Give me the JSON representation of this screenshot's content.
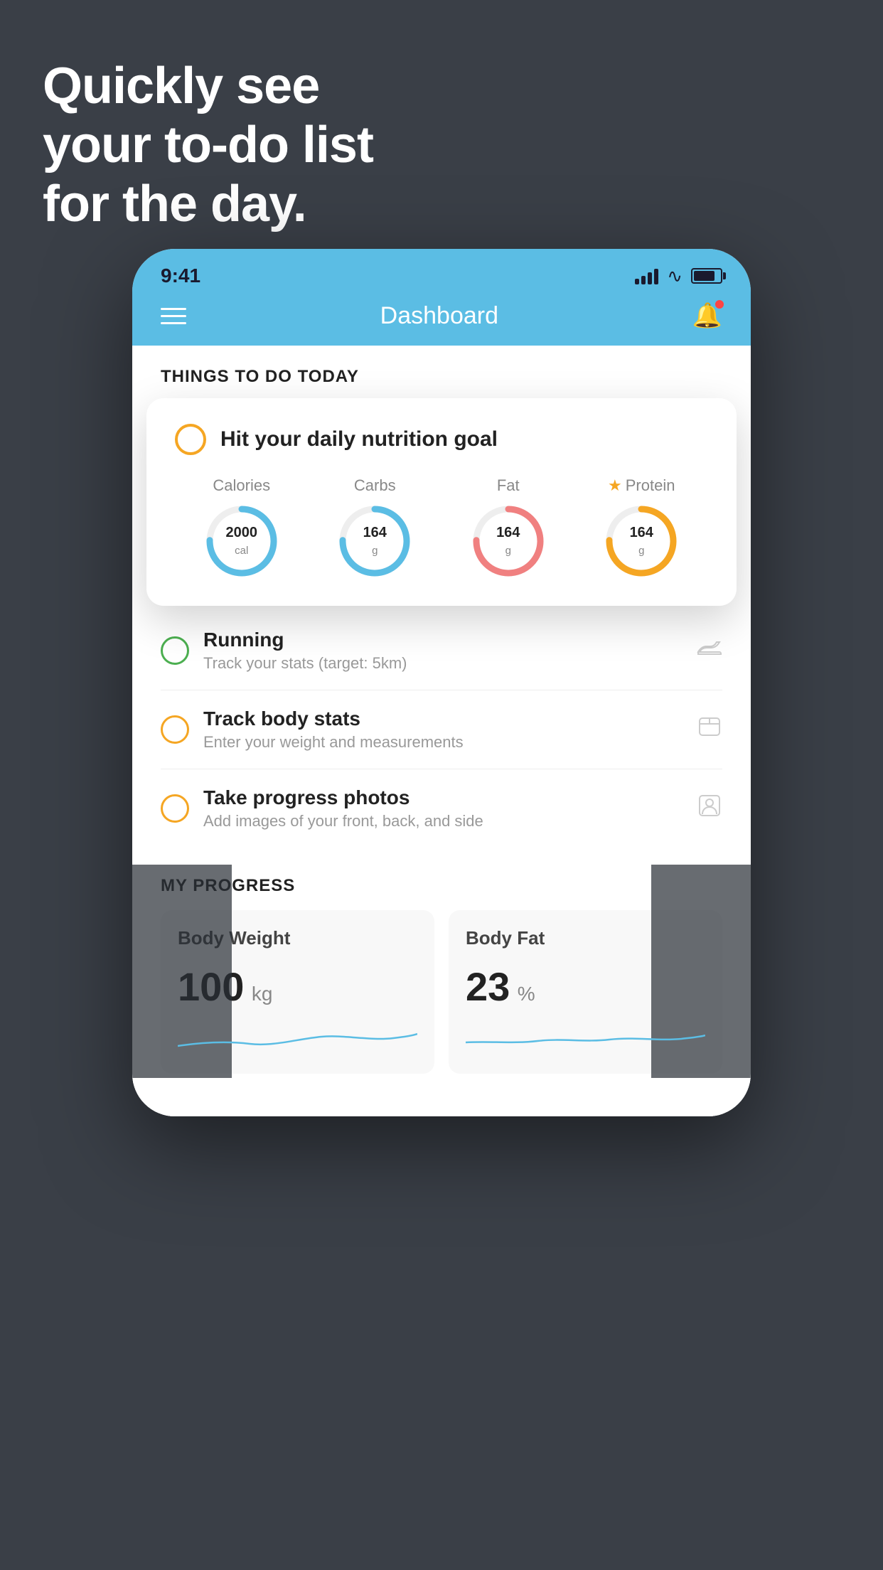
{
  "background": {
    "color": "#3a3f47"
  },
  "headline": {
    "line1": "Quickly see",
    "line2": "your to-do list",
    "line3": "for the day."
  },
  "phone": {
    "status_bar": {
      "time": "9:41"
    },
    "nav": {
      "title": "Dashboard"
    },
    "things_section": {
      "title": "THINGS TO DO TODAY"
    },
    "floating_card": {
      "checkbox_color": "#f5a623",
      "title": "Hit your daily nutrition goal",
      "nutrition": [
        {
          "label": "Calories",
          "value": "2000",
          "unit": "cal",
          "color": "#5bbde4",
          "starred": false
        },
        {
          "label": "Carbs",
          "value": "164",
          "unit": "g",
          "color": "#5bbde4",
          "starred": false
        },
        {
          "label": "Fat",
          "value": "164",
          "unit": "g",
          "color": "#f08080",
          "starred": false
        },
        {
          "label": "Protein",
          "value": "164",
          "unit": "g",
          "color": "#f5a623",
          "starred": true
        }
      ]
    },
    "todo_items": [
      {
        "id": "running",
        "circle_color": "green",
        "title": "Running",
        "subtitle": "Track your stats (target: 5km)",
        "icon": "shoe"
      },
      {
        "id": "body-stats",
        "circle_color": "yellow",
        "title": "Track body stats",
        "subtitle": "Enter your weight and measurements",
        "icon": "scale"
      },
      {
        "id": "progress-photos",
        "circle_color": "yellow",
        "title": "Take progress photos",
        "subtitle": "Add images of your front, back, and side",
        "icon": "person"
      }
    ],
    "progress_section": {
      "title": "MY PROGRESS",
      "cards": [
        {
          "id": "body-weight",
          "title": "Body Weight",
          "value": "100",
          "unit": "kg"
        },
        {
          "id": "body-fat",
          "title": "Body Fat",
          "value": "23",
          "unit": "%"
        }
      ]
    }
  }
}
